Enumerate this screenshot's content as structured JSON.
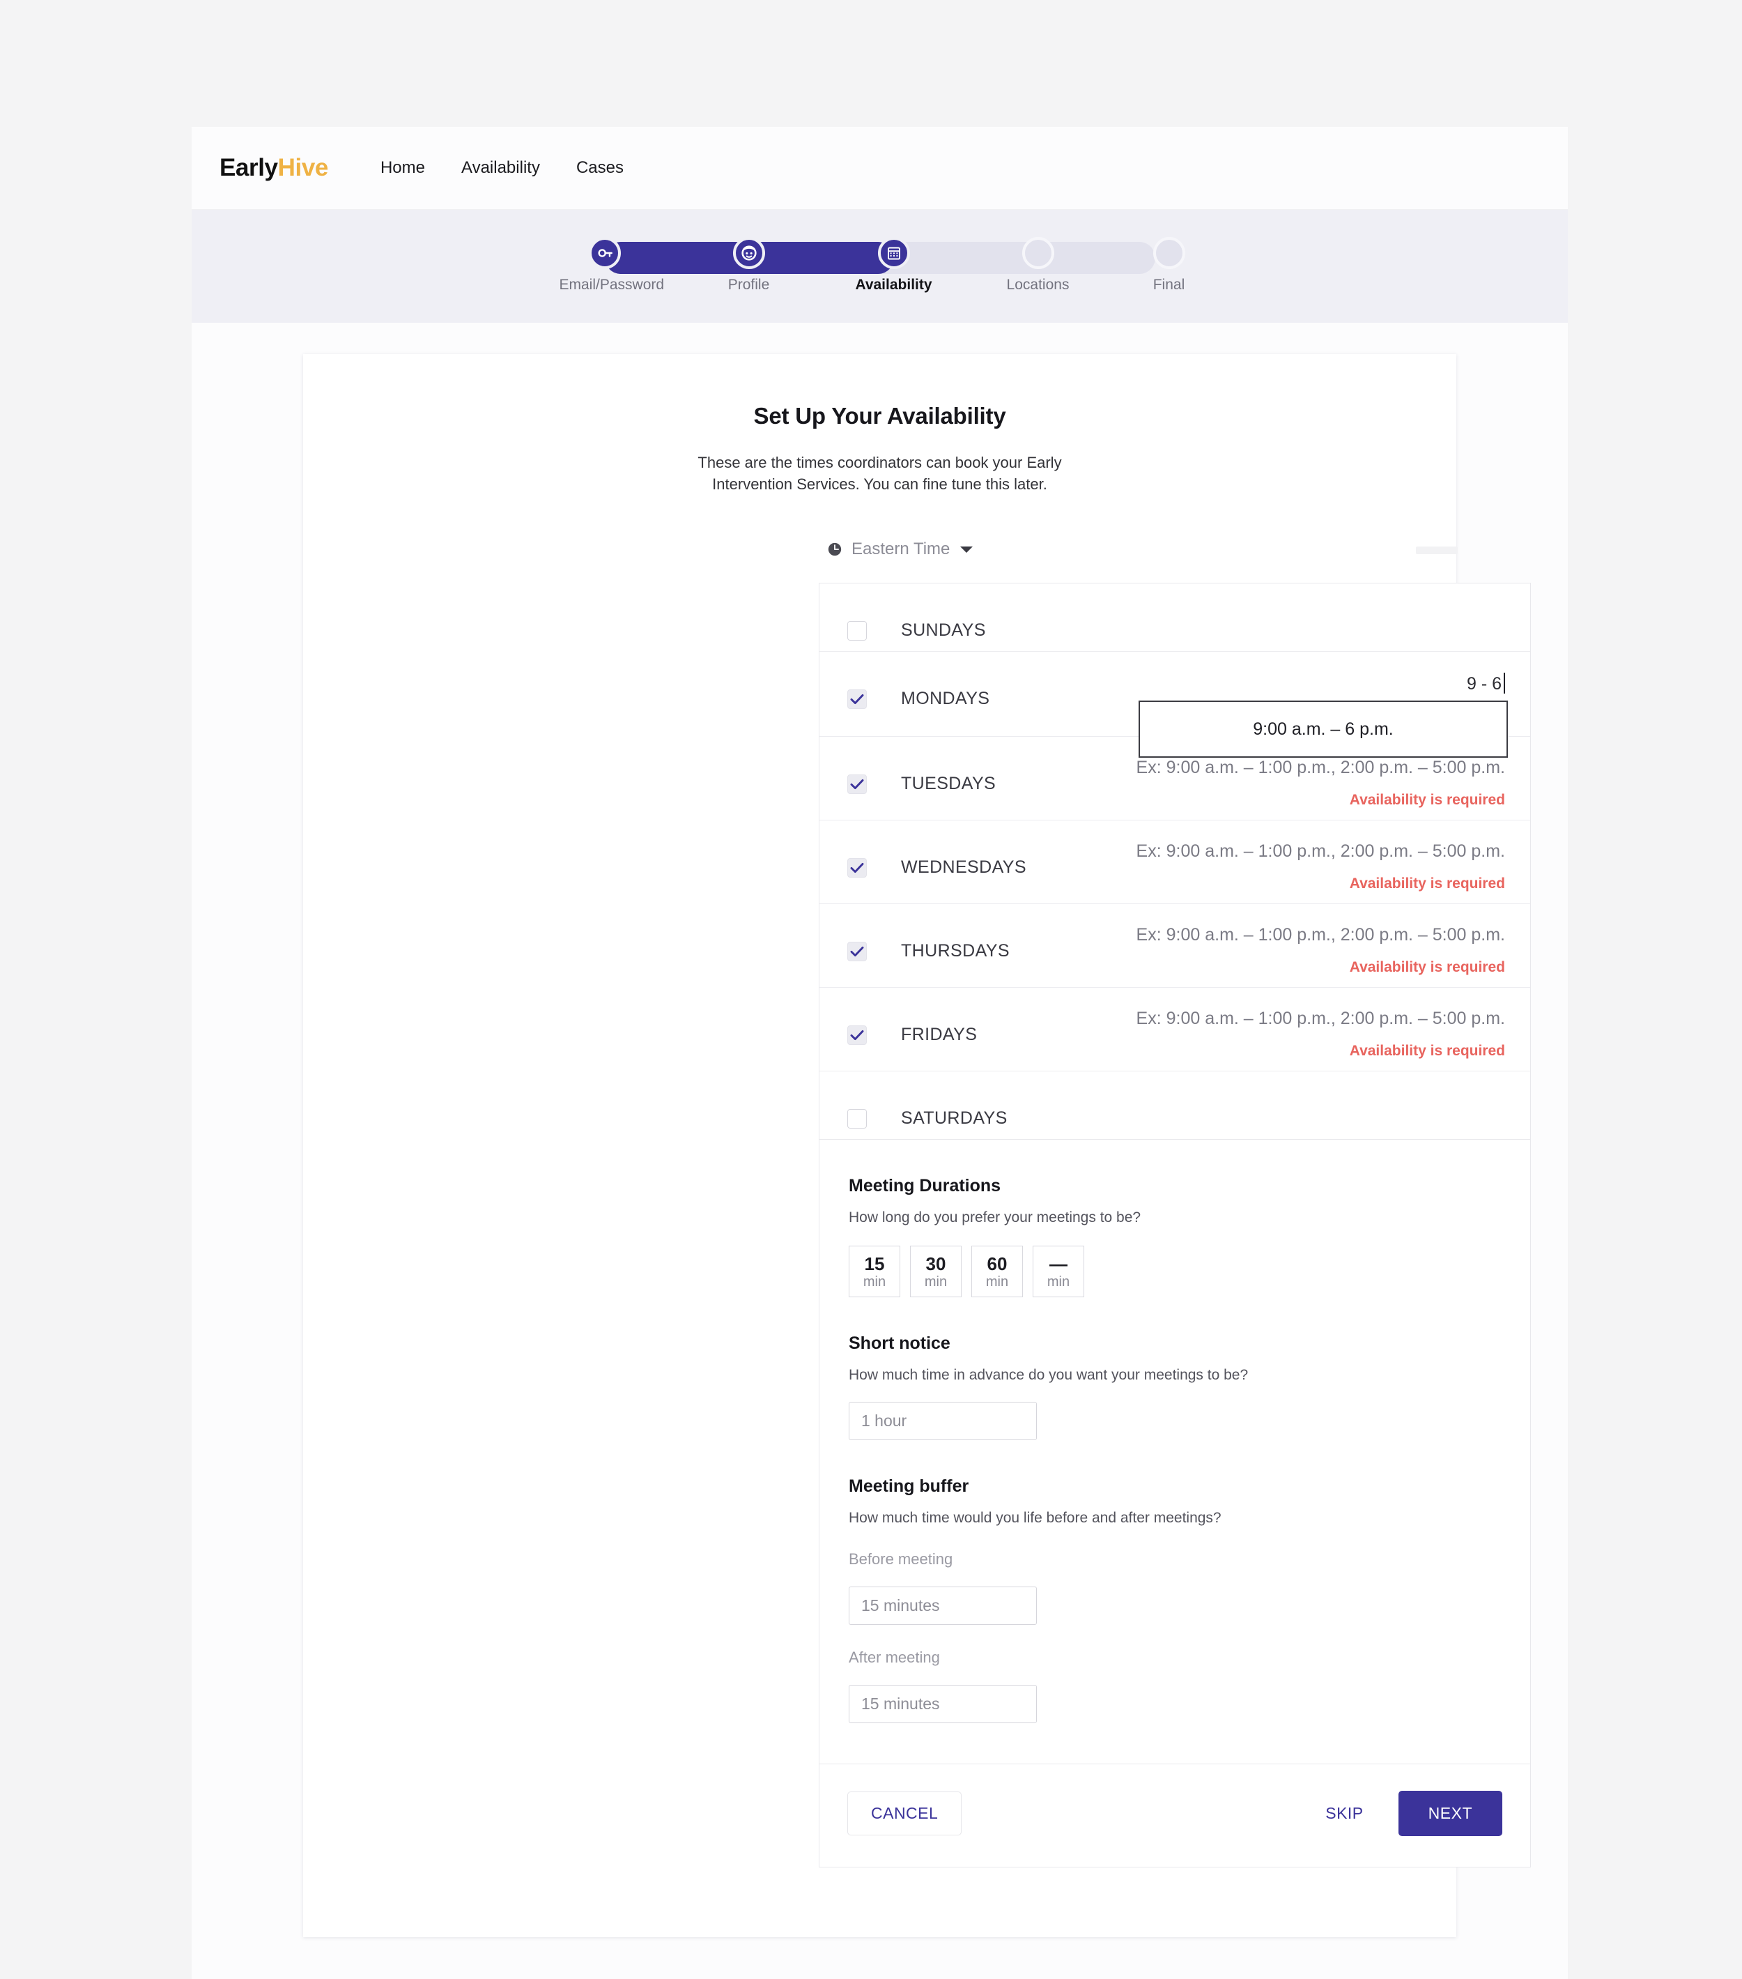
{
  "colors": {
    "brand_purple": "#3B339A",
    "logo_accent": "#EFB244",
    "error_red": "#E8645E",
    "band_bg": "#EFEFF5",
    "page_bg": "#F4F4F5"
  },
  "nav": {
    "logo_first": "Early",
    "logo_second": "Hive",
    "links": [
      {
        "label": "Home"
      },
      {
        "label": "Availability"
      },
      {
        "label": "Cases"
      }
    ]
  },
  "stepper": {
    "steps": [
      {
        "label": "Email/Password",
        "icon": "key-icon",
        "state": "done"
      },
      {
        "label": "Profile",
        "icon": "face-icon",
        "state": "done"
      },
      {
        "label": "Availability",
        "icon": "calendar-icon",
        "state": "active"
      },
      {
        "label": "Locations",
        "icon": "blank-icon",
        "state": "todo"
      },
      {
        "label": "Final",
        "icon": "blank-icon",
        "state": "todo"
      }
    ]
  },
  "card": {
    "title": "Set Up Your Availability",
    "subtitle": "These are the times coordinators can book your Early Intervention Services. You can fine tune this later."
  },
  "timezone": {
    "icon": "clock-icon",
    "label": "Eastern Time",
    "caret": "chevron-down-icon"
  },
  "days": {
    "placeholder_example": "Ex: 9:00 a.m. – 1:00 p.m.,  2:00 p.m. – 5:00 p.m.",
    "error_text": "Availability is required",
    "rows": [
      {
        "label": "SUNDAYS",
        "checked": false,
        "value": "",
        "placeholder": "",
        "error": ""
      },
      {
        "label": "MONDAYS",
        "checked": true,
        "value": "9 - 6",
        "placeholder": "",
        "error": "Availability is required"
      },
      {
        "label": "TUESDAYS",
        "checked": true,
        "value": "",
        "placeholder": "Ex: 9:00 a.m. – 1:00 p.m.,  2:00 p.m. – 5:00 p.m.",
        "error": "Availability is required"
      },
      {
        "label": "WEDNESDAYS",
        "checked": true,
        "value": "",
        "placeholder": "Ex: 9:00 a.m. – 1:00 p.m.,  2:00 p.m. – 5:00 p.m.",
        "error": "Availability is required"
      },
      {
        "label": "THURSDAYS",
        "checked": true,
        "value": "",
        "placeholder": "Ex: 9:00 a.m. – 1:00 p.m.,  2:00 p.m. – 5:00 p.m.",
        "error": "Availability is required"
      },
      {
        "label": "FRIDAYS",
        "checked": true,
        "value": "",
        "placeholder": "Ex: 9:00 a.m. – 1:00 p.m.,  2:00 p.m. – 5:00 p.m.",
        "error": "Availability is required"
      },
      {
        "label": "SATURDAYS",
        "checked": false,
        "value": "",
        "placeholder": "",
        "error": ""
      }
    ]
  },
  "suggestion": {
    "options": [
      {
        "label": "9:00 a.m. – 6 p.m."
      }
    ]
  },
  "meeting_durations": {
    "title": "Meeting Durations",
    "question": "How long do you prefer your meetings to be?",
    "options": [
      {
        "value": "15",
        "unit": "min"
      },
      {
        "value": "30",
        "unit": "min"
      },
      {
        "value": "60",
        "unit": "min"
      },
      {
        "value": "—",
        "unit": "min"
      }
    ]
  },
  "short_notice": {
    "title": "Short notice",
    "question": "How much time in advance do you want your meetings to be?",
    "placeholder": "1 hour"
  },
  "meeting_buffer": {
    "title": "Meeting buffer",
    "question": "How much time would you life before and after meetings?",
    "before_label": "Before meeting",
    "before_placeholder": "15 minutes",
    "after_label": "After meeting",
    "after_placeholder": "15 minutes"
  },
  "footer": {
    "cancel_label": "CANCEL",
    "skip_label": "SKIP",
    "next_label": "NEXT"
  }
}
